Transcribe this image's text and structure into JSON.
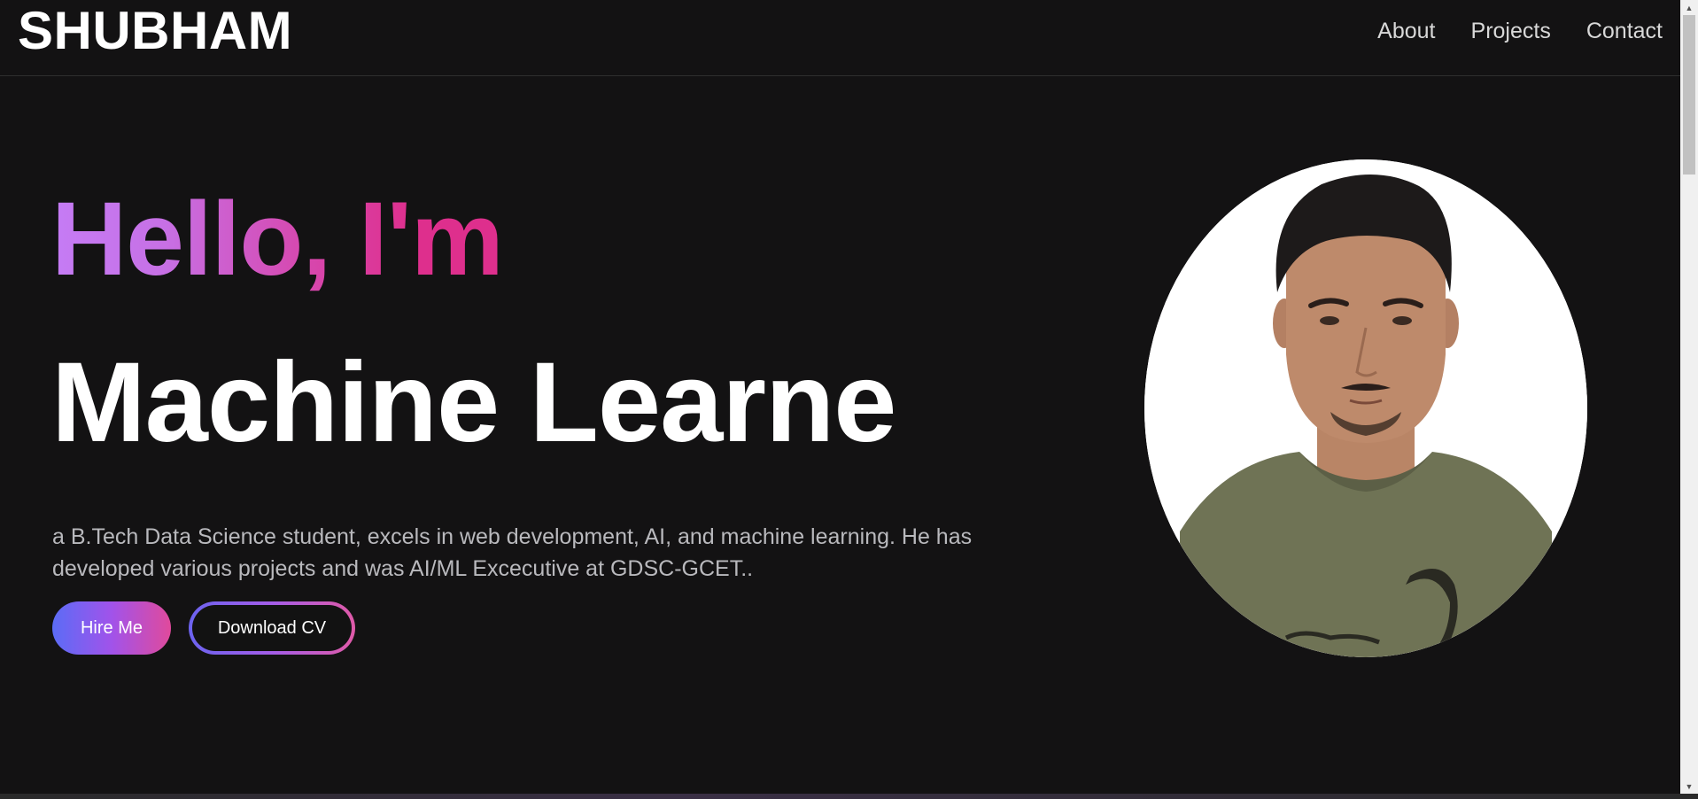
{
  "header": {
    "brand": "SHUBHAM",
    "nav": [
      {
        "label": "About"
      },
      {
        "label": "Projects"
      },
      {
        "label": "Contact"
      }
    ]
  },
  "hero": {
    "greeting": "Hello, I'm",
    "role": "Machine Learne",
    "bio": "a B.Tech Data Science student, excels in web development, AI, and machine learning. He has developed various projects and was AI/ML Excecutive at GDSC-GCET..",
    "hire_label": "Hire Me",
    "cv_label": "Download CV"
  },
  "colors": {
    "background": "#121212",
    "gradient_start": "#c57cf5",
    "gradient_end": "#de2f8d",
    "button_gradient_start": "#5b6cf6",
    "button_gradient_end": "#e04a9c"
  }
}
